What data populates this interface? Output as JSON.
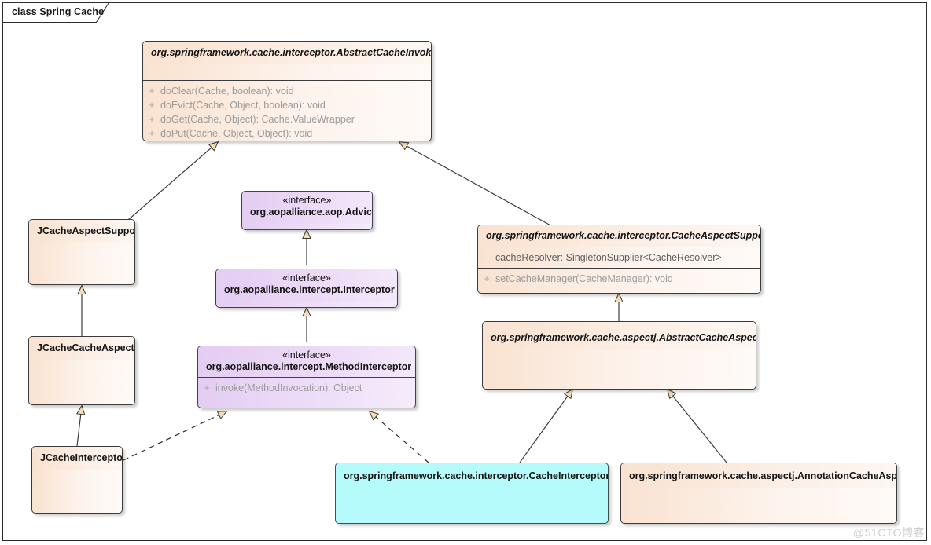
{
  "diagram": {
    "kind": "uml-class-diagram",
    "frame_label": "class Spring Cache",
    "watermark": "@51CTO博客",
    "colors": {
      "abstract_class_fill": "#f9e2d0",
      "interface_fill": "#e3cdf2",
      "highlight_fill": "#b5fbfb",
      "border": "#3b3b3b",
      "arrow_fill": "#f6dcb4",
      "member_text": "#9b9b9b"
    }
  },
  "nodes": {
    "abstract_cache_invoker": {
      "stereotype": "",
      "name": "org.springframework.cache.interceptor.AbstractCacheInvoker",
      "abstract": true,
      "style": "orange",
      "members": [
        {
          "visibility": "+",
          "signature": "doClear(Cache, boolean): void",
          "kind": "operation"
        },
        {
          "visibility": "+",
          "signature": "doEvict(Cache, Object, boolean): void",
          "kind": "operation"
        },
        {
          "visibility": "+",
          "signature": "doGet(Cache, Object): Cache.ValueWrapper",
          "kind": "operation"
        },
        {
          "visibility": "+",
          "signature": "doPut(Cache, Object, Object): void",
          "kind": "operation"
        }
      ]
    },
    "jcache_aspect_support": {
      "stereotype": "",
      "name": "JCacheAspectSupport",
      "abstract": false,
      "style": "orange",
      "members": []
    },
    "jcache_cache_aspect": {
      "stereotype": "",
      "name": "JCacheCacheAspect",
      "abstract": false,
      "style": "orange",
      "members": []
    },
    "jcache_interceptor": {
      "stereotype": "",
      "name": "JCacheInterceptor",
      "abstract": false,
      "style": "orange",
      "members": []
    },
    "advice": {
      "stereotype": "«interface»",
      "name": "org.aopalliance.aop.Advice",
      "abstract": false,
      "style": "purple",
      "members": []
    },
    "interceptor": {
      "stereotype": "«interface»",
      "name": "org.aopalliance.intercept.Interceptor",
      "abstract": false,
      "style": "purple",
      "members": []
    },
    "method_interceptor": {
      "stereotype": "«interface»",
      "name": "org.aopalliance.intercept.MethodInterceptor",
      "abstract": false,
      "style": "purple",
      "members": [
        {
          "visibility": "+",
          "signature": "invoke(MethodInvocation): Object",
          "kind": "operation"
        }
      ]
    },
    "cache_aspect_support": {
      "stereotype": "",
      "name": "org.springframework.cache.interceptor.CacheAspectSupport",
      "abstract": true,
      "style": "orange",
      "members": [
        {
          "visibility": "-",
          "signature": "cacheResolver: SingletonSupplier<CacheResolver>",
          "kind": "attribute"
        },
        {
          "visibility": "+",
          "signature": "setCacheManager(CacheManager): void",
          "kind": "operation"
        }
      ]
    },
    "abstract_cache_aspect": {
      "stereotype": "",
      "name": "org.springframework.cache.aspectj.AbstractCacheAspect",
      "abstract": true,
      "style": "orange",
      "members": []
    },
    "cache_interceptor": {
      "stereotype": "",
      "name": "org.springframework.cache.interceptor.CacheInterceptor",
      "abstract": false,
      "style": "cyan",
      "members": []
    },
    "annotation_cache_aspect": {
      "stereotype": "",
      "name": "org.springframework.cache.aspectj.AnnotationCacheAspect",
      "abstract": false,
      "style": "orange",
      "members": []
    }
  },
  "relationships": [
    {
      "from": "jcache_aspect_support",
      "to": "abstract_cache_invoker",
      "type": "generalization"
    },
    {
      "from": "cache_aspect_support",
      "to": "abstract_cache_invoker",
      "type": "generalization"
    },
    {
      "from": "jcache_cache_aspect",
      "to": "jcache_aspect_support",
      "type": "generalization"
    },
    {
      "from": "jcache_interceptor",
      "to": "jcache_cache_aspect",
      "type": "generalization"
    },
    {
      "from": "interceptor",
      "to": "advice",
      "type": "generalization"
    },
    {
      "from": "method_interceptor",
      "to": "interceptor",
      "type": "generalization"
    },
    {
      "from": "abstract_cache_aspect",
      "to": "cache_aspect_support",
      "type": "generalization"
    },
    {
      "from": "cache_interceptor",
      "to": "abstract_cache_aspect",
      "type": "generalization"
    },
    {
      "from": "annotation_cache_aspect",
      "to": "abstract_cache_aspect",
      "type": "generalization"
    },
    {
      "from": "jcache_interceptor",
      "to": "method_interceptor",
      "type": "realization"
    },
    {
      "from": "cache_interceptor",
      "to": "method_interceptor",
      "type": "realization"
    }
  ]
}
